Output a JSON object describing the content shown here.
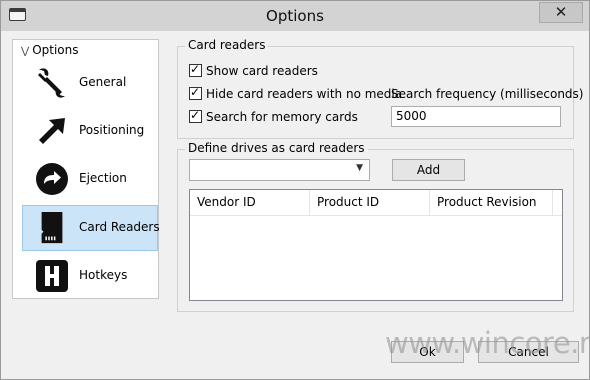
{
  "window": {
    "title": "Options",
    "close_glyph": "✕",
    "icon": "window-app-icon"
  },
  "sidebar": {
    "header": "Options",
    "header_icon": "double-chevron-down-icon",
    "items": [
      {
        "label": "General",
        "icon": "wrench-icon",
        "selected": false
      },
      {
        "label": "Positioning",
        "icon": "arrow-up-right-icon",
        "selected": false
      },
      {
        "label": "Ejection",
        "icon": "circle-arrow-right-icon",
        "selected": false
      },
      {
        "label": "Card Readers",
        "icon": "sd-card-icon",
        "selected": true
      },
      {
        "label": "Hotkeys",
        "icon": "h-key-icon",
        "selected": false
      }
    ]
  },
  "card_readers": {
    "group_title": "Card readers",
    "show_card_readers": {
      "label": "Show card readers",
      "checked": true
    },
    "hide_no_media": {
      "label": "Hide card readers with no media",
      "checked": true
    },
    "search_memory": {
      "label": "Search for memory cards",
      "checked": true
    },
    "search_frequency": {
      "label": "Search frequency (milliseconds)",
      "value": "5000"
    }
  },
  "define_drives": {
    "group_title": "Define drives as card readers",
    "selected_drive": "",
    "add_label": "Add",
    "columns": [
      "Vendor ID",
      "Product ID",
      "Product Revision"
    ],
    "rows": []
  },
  "footer": {
    "ok_label": "Ok",
    "cancel_label": "Cancel"
  },
  "watermark": "www.wincore.ru",
  "colors": {
    "selection": "#cce4f7",
    "selection_border": "#99c9ef",
    "titlebar": "#d3d3d3",
    "background": "#f0f0f0"
  }
}
